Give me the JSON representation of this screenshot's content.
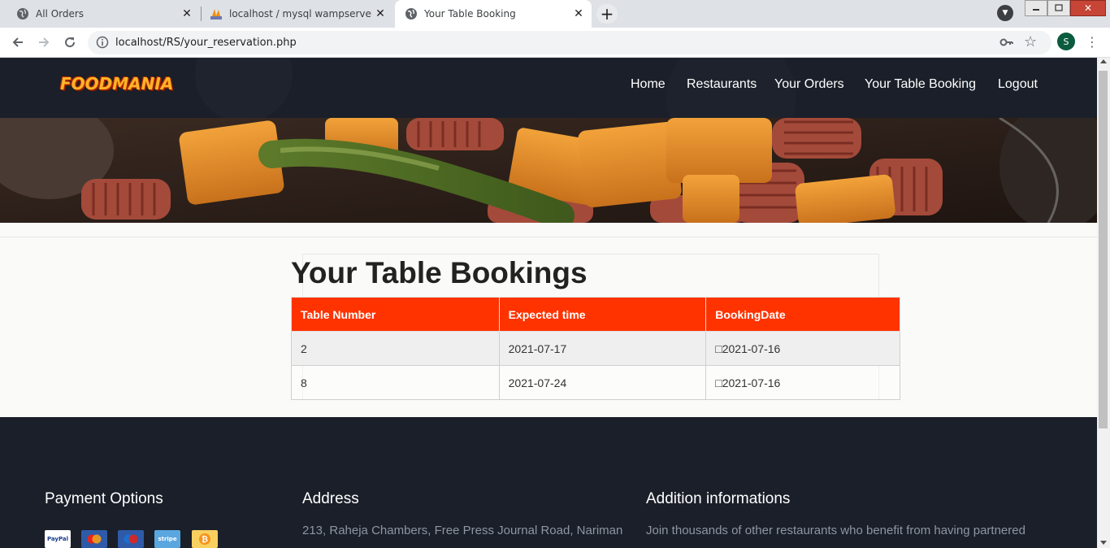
{
  "browser": {
    "tabs": [
      {
        "title": "All Orders",
        "icon": "globe-icon"
      },
      {
        "title": "localhost / mysql wampserver / d",
        "icon": "phpmyadmin-icon"
      },
      {
        "title": "Your Table Booking",
        "icon": "globe-icon",
        "active": true
      }
    ],
    "url": "localhost/RS/your_reservation.php",
    "profile_initial": "S"
  },
  "site": {
    "logo_text": "FOODMANIA",
    "nav": [
      "Home",
      "Restaurants",
      "Your Orders",
      "Your Table Booking",
      "Logout"
    ]
  },
  "main": {
    "title": "Your Table Bookings",
    "table": {
      "headers": [
        "Table Number",
        "Expected time",
        "BookingDate"
      ],
      "rows": [
        [
          "2",
          "2021-07-17",
          "□2021-07-16"
        ],
        [
          "8",
          "2021-07-24",
          "□2021-07-16"
        ]
      ]
    }
  },
  "footer": {
    "payment_title": "Payment Options",
    "payment_methods": [
      "PayPal",
      "mastercard",
      "maestro",
      "stripe",
      "bitcoin"
    ],
    "address_title": "Address",
    "address_text": "213, Raheja Chambers, Free Press Journal Road, Nariman",
    "info_title": "Addition informations",
    "info_text": "Join thousands of other restaurants who benefit from having partnered"
  },
  "colors": {
    "accent": "#ff3300",
    "header_bg": "#1a1f29",
    "logo": "#ffb328"
  }
}
